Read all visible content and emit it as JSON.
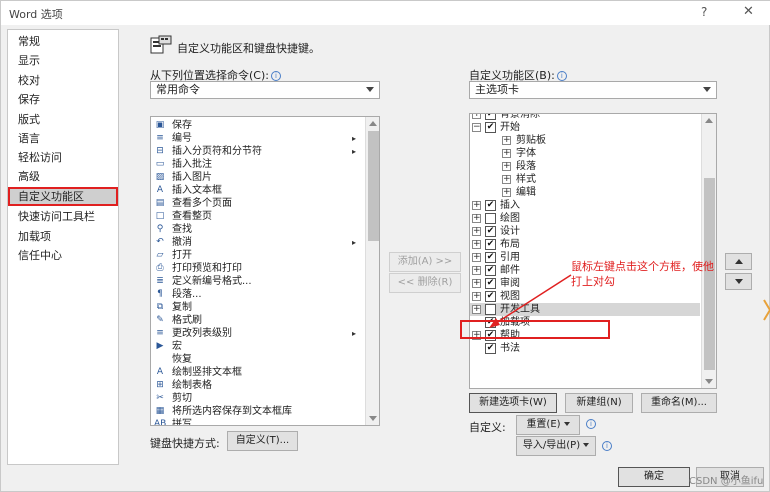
{
  "window": {
    "title": "Word 选项",
    "help": "?",
    "close": "✕"
  },
  "nav": {
    "items": [
      {
        "label": "常规"
      },
      {
        "label": "显示"
      },
      {
        "label": "校对"
      },
      {
        "label": "保存"
      },
      {
        "label": "版式"
      },
      {
        "label": "语言"
      },
      {
        "label": "轻松访问"
      },
      {
        "label": "高级"
      },
      {
        "label": "自定义功能区",
        "selected": true
      },
      {
        "label": "快速访问工具栏"
      },
      {
        "label": "加载项"
      },
      {
        "label": "信任中心"
      }
    ]
  },
  "header": {
    "title": "自定义功能区和键盘快捷键。"
  },
  "left_panel": {
    "choose_label": "从下列位置选择命令(C):",
    "choose_value": "常用命令",
    "commands": [
      {
        "label": "保存",
        "icon": "save-icon",
        "glyph": "▣"
      },
      {
        "label": "编号",
        "icon": "numbering-icon",
        "glyph": "≡",
        "has_sub": true
      },
      {
        "label": "插入分页符和分节符",
        "icon": "page-break-icon",
        "glyph": "⊟",
        "has_sub": true
      },
      {
        "label": "插入批注",
        "icon": "comment-icon",
        "glyph": "▭"
      },
      {
        "label": "插入图片",
        "icon": "picture-icon",
        "glyph": "▨"
      },
      {
        "label": "插入文本框",
        "icon": "textbox-icon",
        "glyph": "A"
      },
      {
        "label": "查看多个页面",
        "icon": "multipage-icon",
        "glyph": "▤"
      },
      {
        "label": "查看整页",
        "icon": "fullpage-icon",
        "glyph": "□"
      },
      {
        "label": "查找",
        "icon": "find-icon",
        "glyph": "⚲"
      },
      {
        "label": "撤消",
        "icon": "undo-icon",
        "glyph": "↶",
        "has_sub": true
      },
      {
        "label": "打开",
        "icon": "open-icon",
        "glyph": "▱"
      },
      {
        "label": "打印预览和打印",
        "icon": "print-preview-icon",
        "glyph": "⎙"
      },
      {
        "label": "定义新编号格式...",
        "icon": "define-number-icon",
        "glyph": "≣"
      },
      {
        "label": "段落...",
        "icon": "paragraph-icon",
        "glyph": "¶"
      },
      {
        "label": "复制",
        "icon": "copy-icon",
        "glyph": "⧉"
      },
      {
        "label": "格式刷",
        "icon": "format-painter-icon",
        "glyph": "✎"
      },
      {
        "label": "更改列表级别",
        "icon": "list-level-icon",
        "glyph": "≡",
        "has_sub": true
      },
      {
        "label": "宏",
        "icon": "macro-icon",
        "glyph": "▶"
      },
      {
        "label": "恢复",
        "icon": "redo-icon",
        "glyph": ""
      },
      {
        "label": "绘制竖排文本框",
        "icon": "vertical-textbox-icon",
        "glyph": "A"
      },
      {
        "label": "绘制表格",
        "icon": "draw-table-icon",
        "glyph": "⊞"
      },
      {
        "label": "剪切",
        "icon": "cut-icon",
        "glyph": "✂"
      },
      {
        "label": "将所选内容保存到文本框库",
        "icon": "save-selection-icon",
        "glyph": "▦"
      },
      {
        "label": "拼写",
        "icon": "spelling-icon",
        "glyph": "AB"
      }
    ],
    "keyboard_label": "键盘快捷方式:",
    "customize_button": "自定义(T)..."
  },
  "middle": {
    "add_button": "添加(A) >>",
    "remove_button": "<< 删除(R)"
  },
  "right_panel": {
    "customize_label": "自定义功能区(B):",
    "customize_value": "主选项卡",
    "tree": [
      {
        "label": "背景消除",
        "level": 1,
        "expander": "⊞",
        "checked": true,
        "clipped": true
      },
      {
        "label": "开始",
        "level": 1,
        "expander": "⊟",
        "checked": true
      },
      {
        "label": "剪贴板",
        "level": 2,
        "expander": "⊞"
      },
      {
        "label": "字体",
        "level": 2,
        "expander": "⊞"
      },
      {
        "label": "段落",
        "level": 2,
        "expander": "⊞"
      },
      {
        "label": "样式",
        "level": 2,
        "expander": "⊞"
      },
      {
        "label": "编辑",
        "level": 2,
        "expander": "⊞"
      },
      {
        "label": "插入",
        "level": 1,
        "expander": "⊞",
        "checked": true
      },
      {
        "label": "绘图",
        "level": 1,
        "expander": "⊞",
        "checked": false
      },
      {
        "label": "设计",
        "level": 1,
        "expander": "⊞",
        "checked": true
      },
      {
        "label": "布局",
        "level": 1,
        "expander": "⊞",
        "checked": true
      },
      {
        "label": "引用",
        "level": 1,
        "expander": "⊞",
        "checked": true
      },
      {
        "label": "邮件",
        "level": 1,
        "expander": "⊞",
        "checked": true
      },
      {
        "label": "审阅",
        "level": 1,
        "expander": "⊞",
        "checked": true
      },
      {
        "label": "视图",
        "level": 1,
        "expander": "⊞",
        "checked": true
      },
      {
        "label": "开发工具",
        "level": 1,
        "expander": "⊞",
        "checked": false,
        "highlight": true
      },
      {
        "label": "加载项",
        "level": 1,
        "expander": "",
        "checked": true
      },
      {
        "label": "帮助",
        "level": 1,
        "expander": "⊞",
        "checked": true
      },
      {
        "label": "书法",
        "level": 1,
        "expander": "",
        "checked": true
      }
    ],
    "new_tab_button": "新建选项卡(W)",
    "new_group_button": "新建组(N)",
    "rename_button": "重命名(M)...",
    "customizations_label": "自定义:",
    "reset_button": "重置(E)",
    "import_export_button": "导入/导出(P)"
  },
  "annotation": {
    "text": "鼠标左键点击这个方框，使他打上对勾"
  },
  "footer": {
    "ok_button": "确定",
    "cancel_button": "取消",
    "watermark": "CSDN @小鱼ifu"
  },
  "colors": {
    "annotation_red": "#e02020",
    "selected_nav_bg": "#cfcfcf",
    "info_blue": "#4a7ec7"
  }
}
